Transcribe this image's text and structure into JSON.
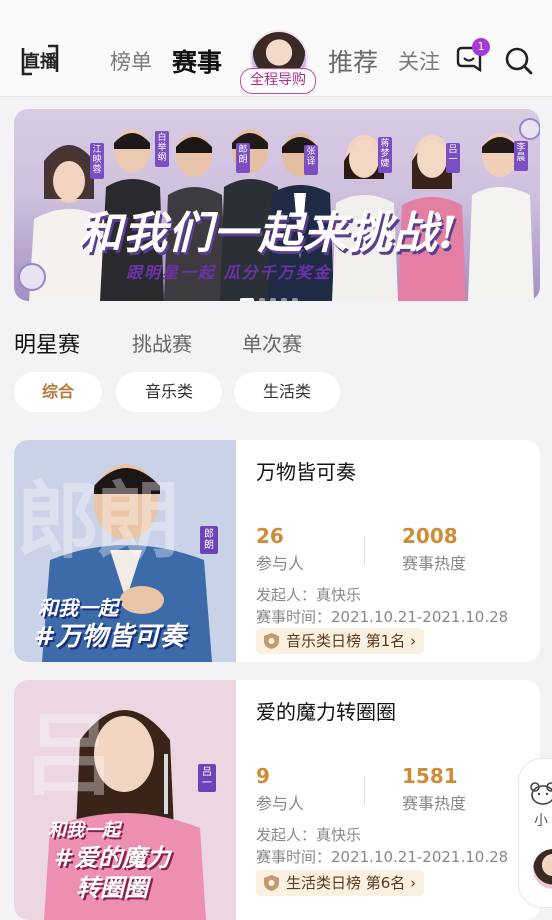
{
  "nav": {
    "logo_text": "直播",
    "tabs": [
      "榜单",
      "赛事",
      "推荐",
      "关注"
    ],
    "active_tab": "赛事",
    "guide_label": "全程导购",
    "message_badge": "1"
  },
  "banner": {
    "slogan": "和我们一起来挑战!",
    "subtitle": "跟明星一起  瓜分千万奖金",
    "names": [
      "江映蓉",
      "白举纲",
      "郎朗",
      "张译",
      "蒋梦婕",
      "吕一",
      "李晨"
    ],
    "slide_count": 5,
    "active_slide": 1
  },
  "category_tabs": [
    "明星赛",
    "挑战赛",
    "单次赛"
  ],
  "active_category": "明星赛",
  "filters": [
    "综合",
    "音乐类",
    "生活类"
  ],
  "active_filter": "综合",
  "cards": [
    {
      "title": "万物皆可奏",
      "participants": "26",
      "participants_label": "参与人",
      "heat": "2008",
      "heat_label": "赛事热度",
      "initiator": "发起人：真快乐",
      "time": "赛事时间：2021.10.21-2021.10.28",
      "rank": "音乐类日榜 第1名",
      "poster_line1": "和我一起",
      "poster_line2": "#万物皆可奏",
      "poster_bg": "郎朗",
      "poster_tag": "郎朗"
    },
    {
      "title": "爱的魔力转圈圈",
      "participants": "9",
      "participants_label": "参与人",
      "heat": "1581",
      "heat_label": "赛事热度",
      "initiator": "发起人：真快乐",
      "time": "赛事时间：2021.10.21-2021.10.28",
      "rank": "生活类日榜 第6名",
      "poster_line1": "和我一起",
      "poster_line2": "#爱的魔力",
      "poster_line3": "转圈圈",
      "poster_bg": "吕",
      "poster_tag": "吕一"
    }
  ],
  "float_widget_label": "小",
  "colors": {
    "accent_orange": "#d28b35",
    "guide_pink": "#c94aa8",
    "badge_purple": "#a43bd7"
  }
}
